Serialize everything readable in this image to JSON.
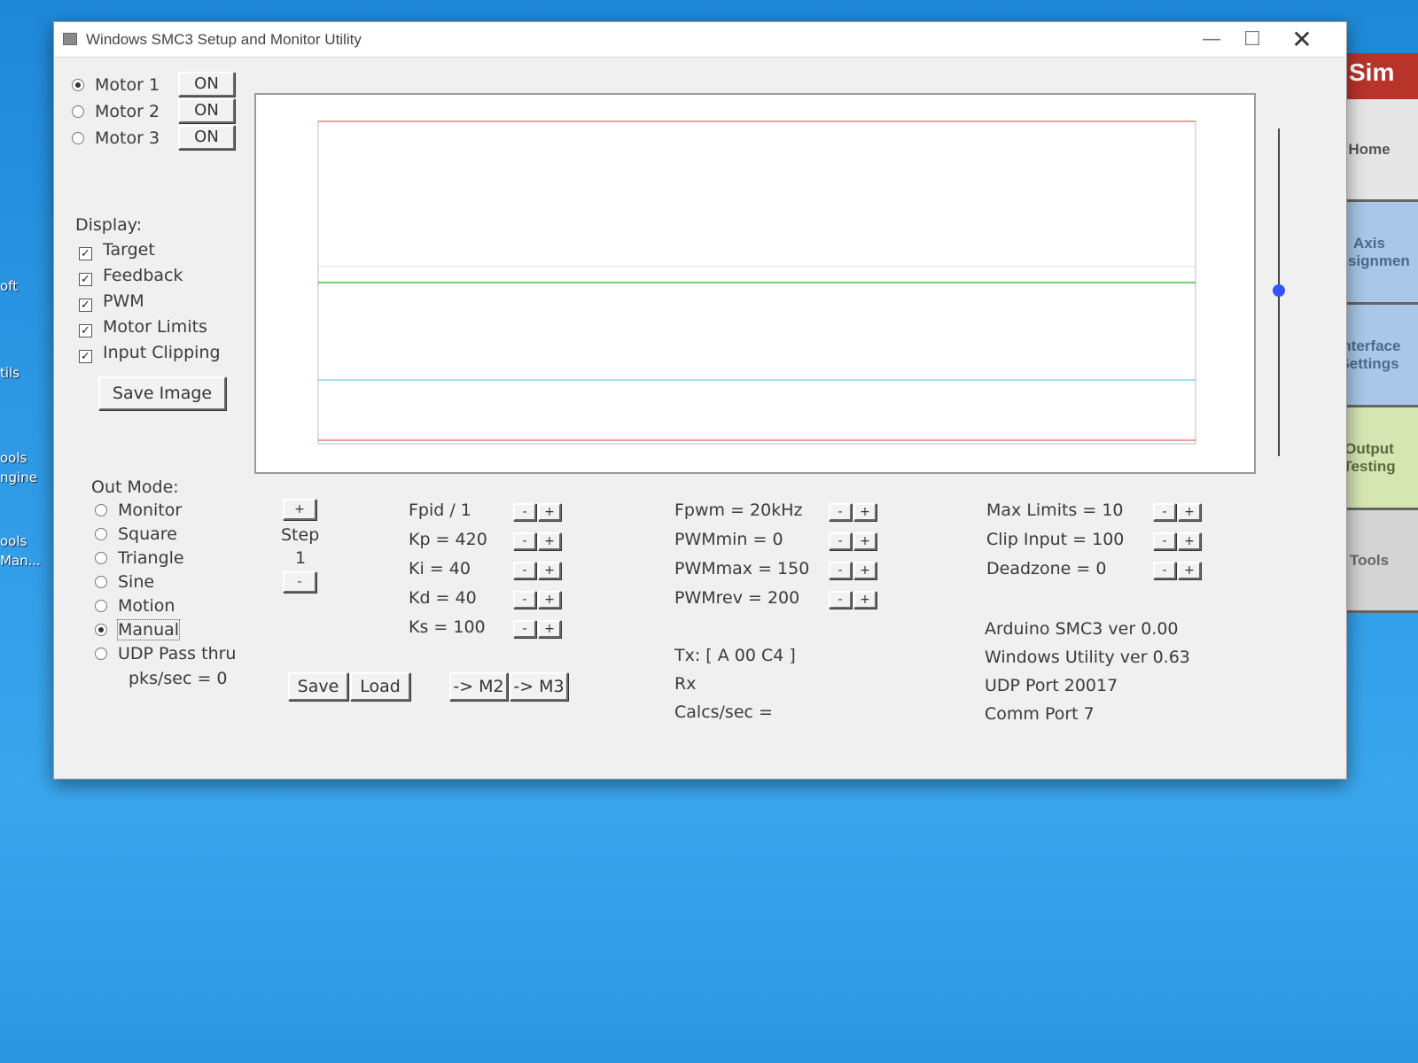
{
  "window": {
    "title": "Windows SMC3 Setup and Monitor Utility",
    "close_glyph": "✕",
    "min_glyph": "—",
    "max_glyph": "☐"
  },
  "motors": [
    {
      "label": "Motor 1",
      "selected": true,
      "button": "ON"
    },
    {
      "label": "Motor 2",
      "selected": false,
      "button": "ON"
    },
    {
      "label": "Motor 3",
      "selected": false,
      "button": "ON"
    }
  ],
  "display": {
    "heading": "Display:",
    "options": [
      {
        "label": "Target",
        "checked": true
      },
      {
        "label": "Feedback",
        "checked": true
      },
      {
        "label": "PWM",
        "checked": true
      },
      {
        "label": "Motor Limits",
        "checked": true
      },
      {
        "label": "Input Clipping",
        "checked": true
      }
    ],
    "save_image": "Save Image"
  },
  "out_mode": {
    "heading": "Out Mode:",
    "options": [
      {
        "label": "Monitor",
        "selected": false
      },
      {
        "label": "Square",
        "selected": false
      },
      {
        "label": "Triangle",
        "selected": false
      },
      {
        "label": "Sine",
        "selected": false
      },
      {
        "label": "Motion",
        "selected": false
      },
      {
        "label": "Manual",
        "selected": true
      },
      {
        "label": "UDP Pass thru",
        "selected": false
      }
    ],
    "pks": "pks/sec = 0"
  },
  "step": {
    "plus": "+",
    "label": "Step",
    "value": "1",
    "minus": "-"
  },
  "pid": [
    {
      "label": "Fpid / 1"
    },
    {
      "label": "Kp = 420"
    },
    {
      "label": "Ki = 40"
    },
    {
      "label": "Kd = 40"
    },
    {
      "label": "Ks = 100"
    }
  ],
  "pwm": [
    {
      "label": "Fpwm = 20kHz"
    },
    {
      "label": "PWMmin = 0"
    },
    {
      "label": "PWMmax = 150"
    },
    {
      "label": "PWMrev = 200"
    }
  ],
  "limits": [
    {
      "label": "Max Limits = 10"
    },
    {
      "label": "Clip Input = 100"
    },
    {
      "label": "Deadzone = 0"
    }
  ],
  "buttons": {
    "save": "Save",
    "load": "Load",
    "to_m2": "-> M2",
    "to_m3": "-> M3",
    "minus": "-",
    "plus": "+"
  },
  "comms": {
    "tx": "Tx: [ A 00 C4 ]",
    "rx": "Rx",
    "calcs": "Calcs/sec ="
  },
  "info": {
    "arduino": "Arduino SMC3 ver 0.00",
    "utility": "Windows Utility ver 0.63",
    "udp": "UDP Port 20017",
    "comm": "Comm Port 7"
  },
  "plot": {
    "line_colors": {
      "limits": "#e88080",
      "target": "#44c444",
      "feedback": "#7fd6e8",
      "grid": "#dddddd"
    }
  },
  "sim_app": {
    "header": "Sim",
    "tabs": [
      "Home",
      "Axis Assignmen",
      "Interface Settings",
      "Output Testing",
      "Tools"
    ]
  },
  "desktop": {
    "labels": [
      "oft",
      "tils",
      "ools",
      "ngine",
      "ools",
      "Man..."
    ]
  }
}
